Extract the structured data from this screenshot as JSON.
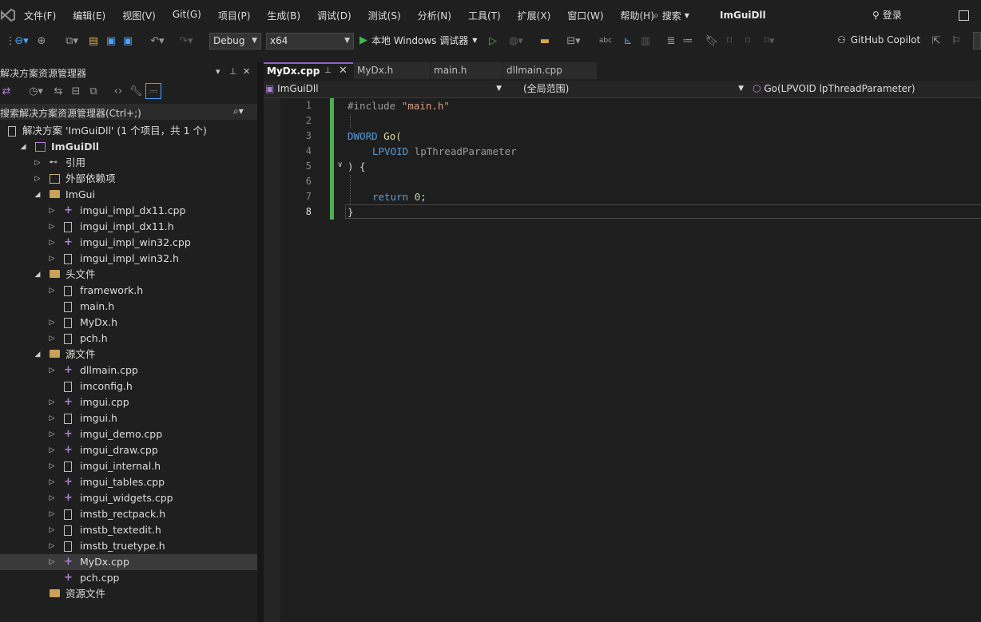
{
  "menubar": {
    "items": [
      "文件(F)",
      "编辑(E)",
      "视图(V)",
      "Git(G)",
      "项目(P)",
      "生成(B)",
      "调试(D)",
      "测试(S)",
      "分析(N)",
      "工具(T)",
      "扩展(X)",
      "窗口(W)",
      "帮助(H)"
    ],
    "search_label": "搜索",
    "app_title": "ImGuiDll",
    "login_label": "登录"
  },
  "toolbar": {
    "config": "Debug",
    "platform": "x64",
    "run_label": "本地 Windows 调试器",
    "copilot_label": "GitHub Copilot"
  },
  "solution_explorer": {
    "title": "解决方案资源管理器",
    "search_placeholder": "搜索解决方案资源管理器(Ctrl+;)",
    "tree": [
      {
        "label": "解决方案 'ImGuiDll' (1 个项目，共 1 个)",
        "type": "solution",
        "indent": 0,
        "chev": ""
      },
      {
        "label": "ImGuiDll",
        "type": "project",
        "indent": 1,
        "chev": "down",
        "bold": true
      },
      {
        "label": "引用",
        "type": "ref",
        "indent": 2,
        "chev": "right"
      },
      {
        "label": "外部依赖项",
        "type": "extdep",
        "indent": 2,
        "chev": "right"
      },
      {
        "label": "ImGui",
        "type": "filter",
        "indent": 2,
        "chev": "down"
      },
      {
        "label": "imgui_impl_dx11.cpp",
        "type": "cpp",
        "indent": 3,
        "chev": "right"
      },
      {
        "label": "imgui_impl_dx11.h",
        "type": "h",
        "indent": 3,
        "chev": "right"
      },
      {
        "label": "imgui_impl_win32.cpp",
        "type": "cpp",
        "indent": 3,
        "chev": "right"
      },
      {
        "label": "imgui_impl_win32.h",
        "type": "h",
        "indent": 3,
        "chev": "right"
      },
      {
        "label": "头文件",
        "type": "filter",
        "indent": 2,
        "chev": "down"
      },
      {
        "label": "framework.h",
        "type": "h",
        "indent": 3,
        "chev": "right"
      },
      {
        "label": "main.h",
        "type": "h",
        "indent": 3,
        "chev": ""
      },
      {
        "label": "MyDx.h",
        "type": "h",
        "indent": 3,
        "chev": "right"
      },
      {
        "label": "pch.h",
        "type": "h",
        "indent": 3,
        "chev": "right"
      },
      {
        "label": "源文件",
        "type": "filter",
        "indent": 2,
        "chev": "down"
      },
      {
        "label": "dllmain.cpp",
        "type": "cpp",
        "indent": 3,
        "chev": "right"
      },
      {
        "label": "imconfig.h",
        "type": "h",
        "indent": 3,
        "chev": ""
      },
      {
        "label": "imgui.cpp",
        "type": "cpp",
        "indent": 3,
        "chev": "right"
      },
      {
        "label": "imgui.h",
        "type": "h",
        "indent": 3,
        "chev": "right"
      },
      {
        "label": "imgui_demo.cpp",
        "type": "cpp",
        "indent": 3,
        "chev": "right"
      },
      {
        "label": "imgui_draw.cpp",
        "type": "cpp",
        "indent": 3,
        "chev": "right"
      },
      {
        "label": "imgui_internal.h",
        "type": "h",
        "indent": 3,
        "chev": "right"
      },
      {
        "label": "imgui_tables.cpp",
        "type": "cpp",
        "indent": 3,
        "chev": "right"
      },
      {
        "label": "imgui_widgets.cpp",
        "type": "cpp",
        "indent": 3,
        "chev": "right"
      },
      {
        "label": "imstb_rectpack.h",
        "type": "h",
        "indent": 3,
        "chev": "right"
      },
      {
        "label": "imstb_textedit.h",
        "type": "h",
        "indent": 3,
        "chev": "right"
      },
      {
        "label": "imstb_truetype.h",
        "type": "h",
        "indent": 3,
        "chev": "right"
      },
      {
        "label": "MyDx.cpp",
        "type": "cpp",
        "indent": 3,
        "chev": "right",
        "selected": true
      },
      {
        "label": "pch.cpp",
        "type": "cpp",
        "indent": 3,
        "chev": ""
      },
      {
        "label": "资源文件",
        "type": "filter",
        "indent": 2,
        "chev": ""
      }
    ]
  },
  "editor": {
    "tabs": [
      {
        "label": "MyDx.cpp",
        "active": true
      },
      {
        "label": "MyDx.h",
        "active": false
      },
      {
        "label": "main.h",
        "active": false
      },
      {
        "label": "dllmain.cpp",
        "active": false
      }
    ],
    "nav_project": "ImGuiDll",
    "nav_scope": "(全局范围)",
    "nav_member": "Go(LPVOID lpThreadParameter)",
    "line_numbers": [
      "1",
      "2",
      "3",
      "4",
      "5",
      "6",
      "7",
      "8"
    ],
    "code": {
      "l1_directive": "#include ",
      "l1_file": "\"main.h\"",
      "l3_type": "DWORD",
      "l3_name": " Go(",
      "l4_type": "LPVOID",
      "l4_param": " lpThreadParameter",
      "l5": ") {",
      "l7_kw": "return",
      "l7_num": "0",
      "l7_end": ";",
      "l8": "}"
    }
  },
  "colors": {
    "accent": "#8e63c9",
    "change_bar": "#4caf50",
    "run_green": "#3fb950"
  }
}
